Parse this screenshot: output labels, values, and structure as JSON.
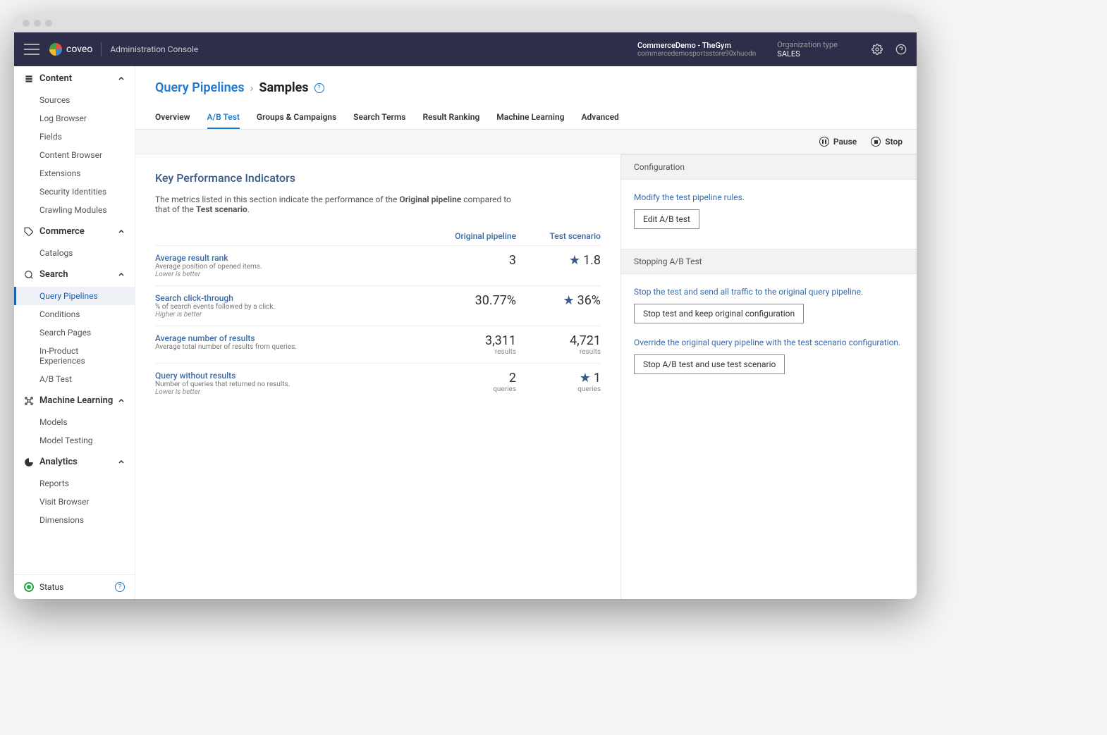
{
  "header": {
    "product": "coveo",
    "console": "Administration Console",
    "org_name": "CommerceDemo - TheGym",
    "org_id": "commercedemosportsstore90xhuodn",
    "org_type_label": "Organization type",
    "org_type_value": "SALES"
  },
  "sidebar": {
    "sections": [
      {
        "label": "Content",
        "items": [
          "Sources",
          "Log Browser",
          "Fields",
          "Content Browser",
          "Extensions",
          "Security Identities",
          "Crawling Modules"
        ]
      },
      {
        "label": "Commerce",
        "items": [
          "Catalogs"
        ]
      },
      {
        "label": "Search",
        "items": [
          "Query Pipelines",
          "Conditions",
          "Search Pages",
          "In-Product Experiences",
          "A/B Test"
        ],
        "active": "Query Pipelines"
      },
      {
        "label": "Machine Learning",
        "items": [
          "Models",
          "Model Testing"
        ]
      },
      {
        "label": "Analytics",
        "items": [
          "Reports",
          "Visit Browser",
          "Dimensions"
        ]
      }
    ],
    "status": "Status"
  },
  "breadcrumb": {
    "parent": "Query Pipelines",
    "current": "Samples"
  },
  "tabs": [
    "Overview",
    "A/B Test",
    "Groups & Campaigns",
    "Search Terms",
    "Result Ranking",
    "Machine Learning",
    "Advanced"
  ],
  "active_tab": "A/B Test",
  "actions": {
    "pause": "Pause",
    "stop": "Stop"
  },
  "kpi": {
    "title": "Key Performance Indicators",
    "description_prefix": "The metrics listed in this section indicate the performance of the ",
    "description_bold1": "Original pipeline",
    "description_mid": " compared to that of the ",
    "description_bold2": "Test scenario",
    "description_suffix": ".",
    "col1": "Original pipeline",
    "col2": "Test scenario",
    "rows": [
      {
        "name": "Average result rank",
        "sub": "Average position of opened items.",
        "note": "Lower is better",
        "v1": "3",
        "v2": "1.8",
        "star": true
      },
      {
        "name": "Search click-through",
        "sub": "% of search events followed by a click.",
        "note": "Higher is better",
        "v1": "30.77%",
        "v2": "36%",
        "star": true
      },
      {
        "name": "Average number of results",
        "sub": "Average total number of results from queries.",
        "note": "",
        "v1": "3,311",
        "v1sub": "results",
        "v2": "4,721",
        "v2sub": "results"
      },
      {
        "name": "Query without results",
        "sub": "Number of queries that returned no results.",
        "note": "Lower is better",
        "v1": "2",
        "v1sub": "queries",
        "v2": "1",
        "v2sub": "queries",
        "star": true
      }
    ]
  },
  "config": {
    "header": "Configuration",
    "text": "Modify the test pipeline rules.",
    "button": "Edit A/B test"
  },
  "stopping": {
    "header": "Stopping A/B Test",
    "text1": "Stop the test and send all traffic to the original query pipeline.",
    "button1": "Stop test and keep original configuration",
    "text2": "Override the original query pipeline with the test scenario configuration.",
    "button2": "Stop A/B test and use test scenario"
  }
}
